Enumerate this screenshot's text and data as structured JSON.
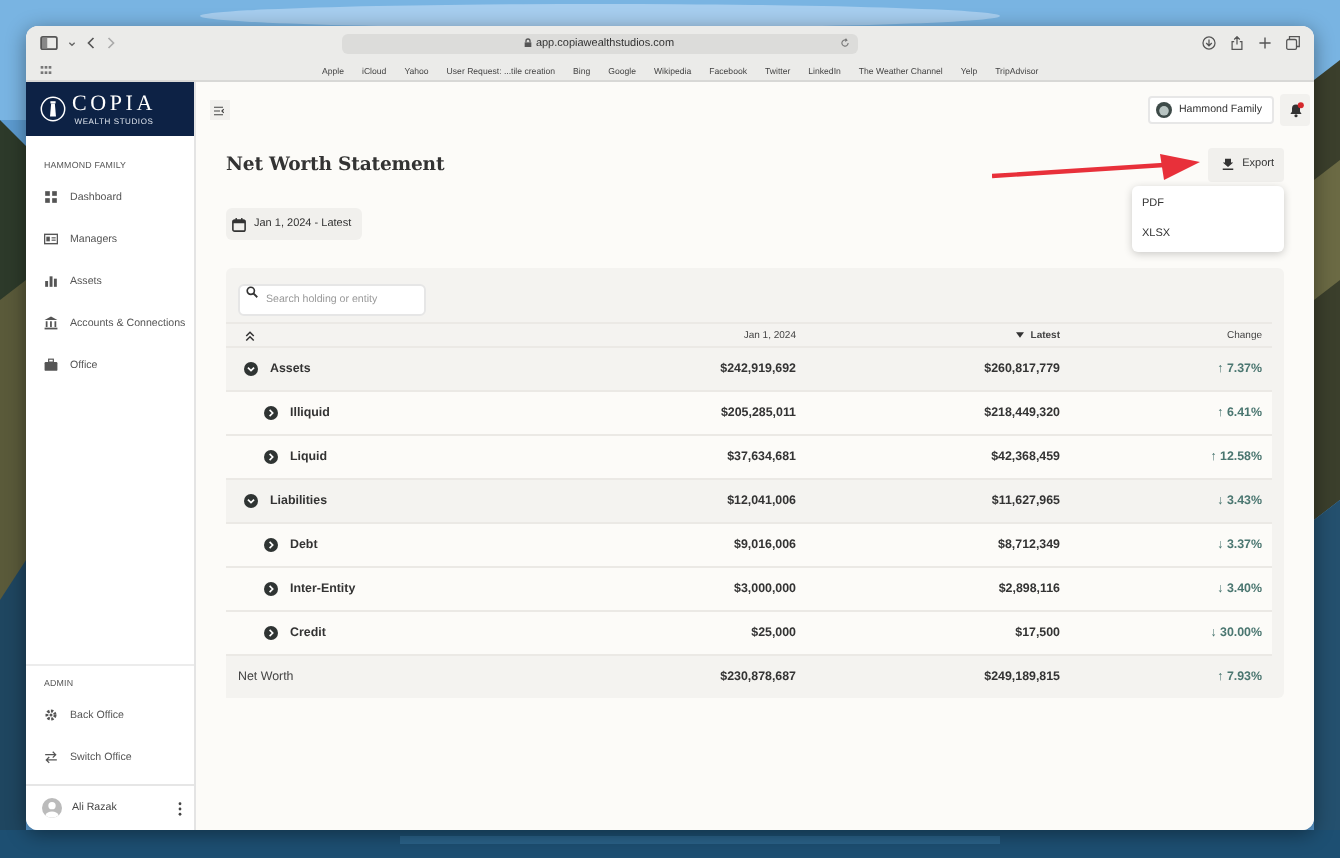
{
  "browser": {
    "url": "app.copiawealthstudios.com",
    "bookmarks": [
      "Apple",
      "iCloud",
      "Yahoo",
      "User Request: ...tile creation",
      "Bing",
      "Google",
      "Wikipedia",
      "Facebook",
      "Twitter",
      "LinkedIn",
      "The Weather Channel",
      "Yelp",
      "TripAdvisor"
    ]
  },
  "sidebar": {
    "logo": {
      "name": "COPIA",
      "tagline": "WEALTH STUDIOS"
    },
    "section": "HAMMOND FAMILY",
    "items": [
      {
        "label": "Dashboard"
      },
      {
        "label": "Managers"
      },
      {
        "label": "Assets"
      },
      {
        "label": "Accounts & Connections"
      },
      {
        "label": "Office"
      }
    ],
    "admin_section": "ADMIN",
    "admin_items": [
      {
        "label": "Back Office"
      },
      {
        "label": "Switch Office"
      }
    ],
    "user": {
      "name": "Ali Razak"
    }
  },
  "topbar": {
    "account": "Hammond Family"
  },
  "page": {
    "title": "Net Worth Statement",
    "export_button": "Export",
    "export_menu": [
      "PDF",
      "XLSX"
    ],
    "date_range": "Jan 1, 2024 - Latest",
    "search": {
      "placeholder": "Search holding or entity"
    }
  },
  "table": {
    "columns": [
      {
        "label": "Jan 1, 2024",
        "sorted": false
      },
      {
        "label": "Latest",
        "sorted": true
      },
      {
        "label": "Change",
        "sorted": false
      }
    ],
    "rows": [
      {
        "label": "Assets",
        "start": "$242,919,692",
        "latest": "$260,817,779",
        "change": "↑ 7.37%",
        "expanded": true,
        "children": [
          {
            "label": "Illiquid",
            "start": "$205,285,011",
            "latest": "$218,449,320",
            "change": "↑ 6.41%",
            "expanded": false
          },
          {
            "label": "Liquid",
            "start": "$37,634,681",
            "latest": "$42,368,459",
            "change": "↑ 12.58%",
            "expanded": false
          }
        ]
      },
      {
        "label": "Liabilities",
        "start": "$12,041,006",
        "latest": "$11,627,965",
        "change": "↓ 3.43%",
        "expanded": true,
        "children": [
          {
            "label": "Debt",
            "start": "$9,016,006",
            "latest": "$8,712,349",
            "change": "↓ 3.37%",
            "expanded": false
          },
          {
            "label": "Inter-Entity",
            "start": "$3,000,000",
            "latest": "$2,898,116",
            "change": "↓ 3.40%",
            "expanded": false
          },
          {
            "label": "Credit",
            "start": "$25,000",
            "latest": "$17,500",
            "change": "↓ 30.00%",
            "expanded": false
          }
        ]
      }
    ],
    "total": {
      "label": "Net Worth",
      "start": "$230,878,687",
      "latest": "$249,189,815",
      "change": "↑ 7.93%"
    }
  }
}
